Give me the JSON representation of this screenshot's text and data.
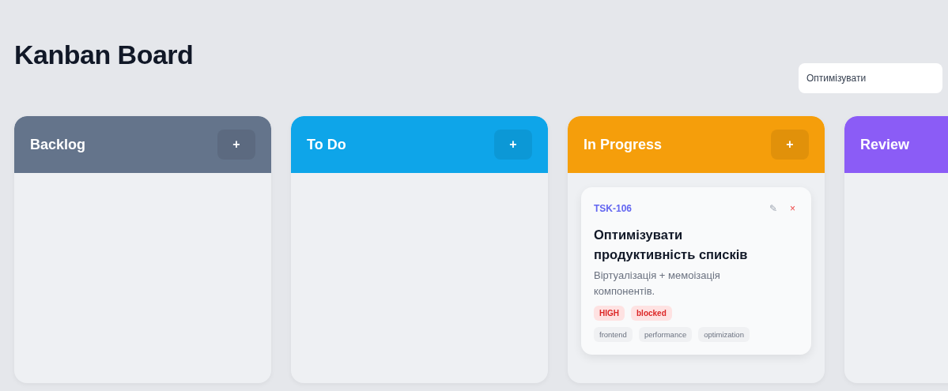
{
  "title": "Kanban Board",
  "search": {
    "value": "Оптимізувати"
  },
  "columns": [
    {
      "name": "Backlog",
      "color": "#64748b",
      "add_label": "+"
    },
    {
      "name": "To Do",
      "color": "#0ea5e9",
      "add_label": "+"
    },
    {
      "name": "In Progress",
      "color": "#f59e0b",
      "add_label": "+",
      "cards": [
        {
          "id": "TSK-106",
          "edit_icon": "✎",
          "delete_icon": "×",
          "title": "Оптимізувати продуктивність списків",
          "description": "Віртуалізація + мемоізація компонентів.",
          "badges": [
            "HIGH",
            "blocked"
          ],
          "tags": [
            "frontend",
            "performance",
            "optimization"
          ]
        }
      ]
    },
    {
      "name": "Review",
      "color": "#8b5cf6"
    }
  ]
}
